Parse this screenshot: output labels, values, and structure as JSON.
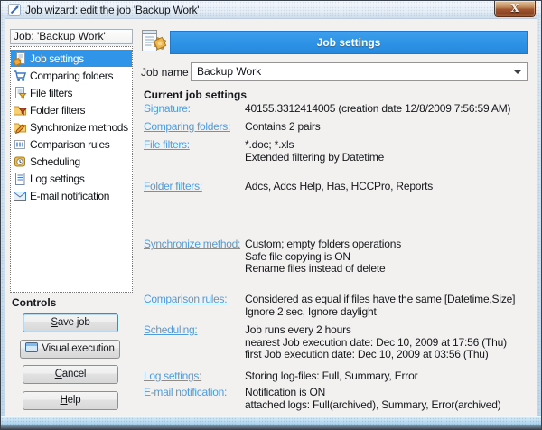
{
  "window": {
    "title": "Job wizard: edit the job 'Backup Work'",
    "close_glyph": "X"
  },
  "sidebar": {
    "header": "Job: 'Backup Work'",
    "items": [
      {
        "label": "Job settings",
        "selected": true
      },
      {
        "label": "Comparing folders"
      },
      {
        "label": "File filters"
      },
      {
        "label": "Folder filters"
      },
      {
        "label": "Synchronize methods"
      },
      {
        "label": "Comparison rules"
      },
      {
        "label": "Scheduling"
      },
      {
        "label": "Log settings"
      },
      {
        "label": "E-mail notification"
      }
    ]
  },
  "controls": {
    "label": "Controls",
    "save": {
      "mnemonic": "S",
      "rest": "ave job"
    },
    "visual": {
      "label": "Visual execution"
    },
    "cancel": {
      "mnemonic": "C",
      "rest": "ancel"
    },
    "help": {
      "mnemonic": "H",
      "rest": "elp"
    }
  },
  "main": {
    "header": "Job settings",
    "job_name_label": "Job name",
    "job_name_value": "Backup Work",
    "heading": "Current job settings",
    "rows": [
      {
        "label": "Signature:",
        "lines": [
          "40155.3312414005 (creation date 12/8/2009 7:56:59 AM)"
        ]
      },
      {
        "label": "Comparing folders:",
        "lines": [
          "Contains 2 pairs"
        ]
      },
      {
        "label": "File filters:",
        "lines": [
          "*.doc; *.xls",
          "Extended filtering by Datetime"
        ]
      },
      {
        "label": "Folder filters:",
        "lines": [
          "Adcs, Adcs Help, Has, HCCPro, Reports"
        ]
      },
      {
        "label": "Synchronize method:",
        "lines": [
          "Custom; empty folders operations",
          "Safe file copying is ON",
          "Rename files instead of delete"
        ]
      },
      {
        "label": "Comparison rules:",
        "lines": [
          "Considered as equal if files have the same [Datetime,Size]",
          "Ignore 2 sec, Ignore daylight"
        ]
      },
      {
        "label": "Scheduling:",
        "lines": [
          "Job runs every 2 hours",
          "nearest Job execution date: Dec 10, 2009 at 17:56 (Thu)",
          "first Job execution date: Dec 10, 2009 at 03:56 (Thu)"
        ]
      },
      {
        "label": "Log settings:",
        "lines": [
          "Storing log-files: Full, Summary, Error"
        ]
      },
      {
        "label": "E-mail notification:",
        "lines": [
          "Notification is ON",
          "attached logs: Full(archived), Summary, Error(archived)"
        ]
      }
    ]
  },
  "colors": {
    "accent_blue": "#3095E8",
    "link_blue": "#509BDB"
  }
}
